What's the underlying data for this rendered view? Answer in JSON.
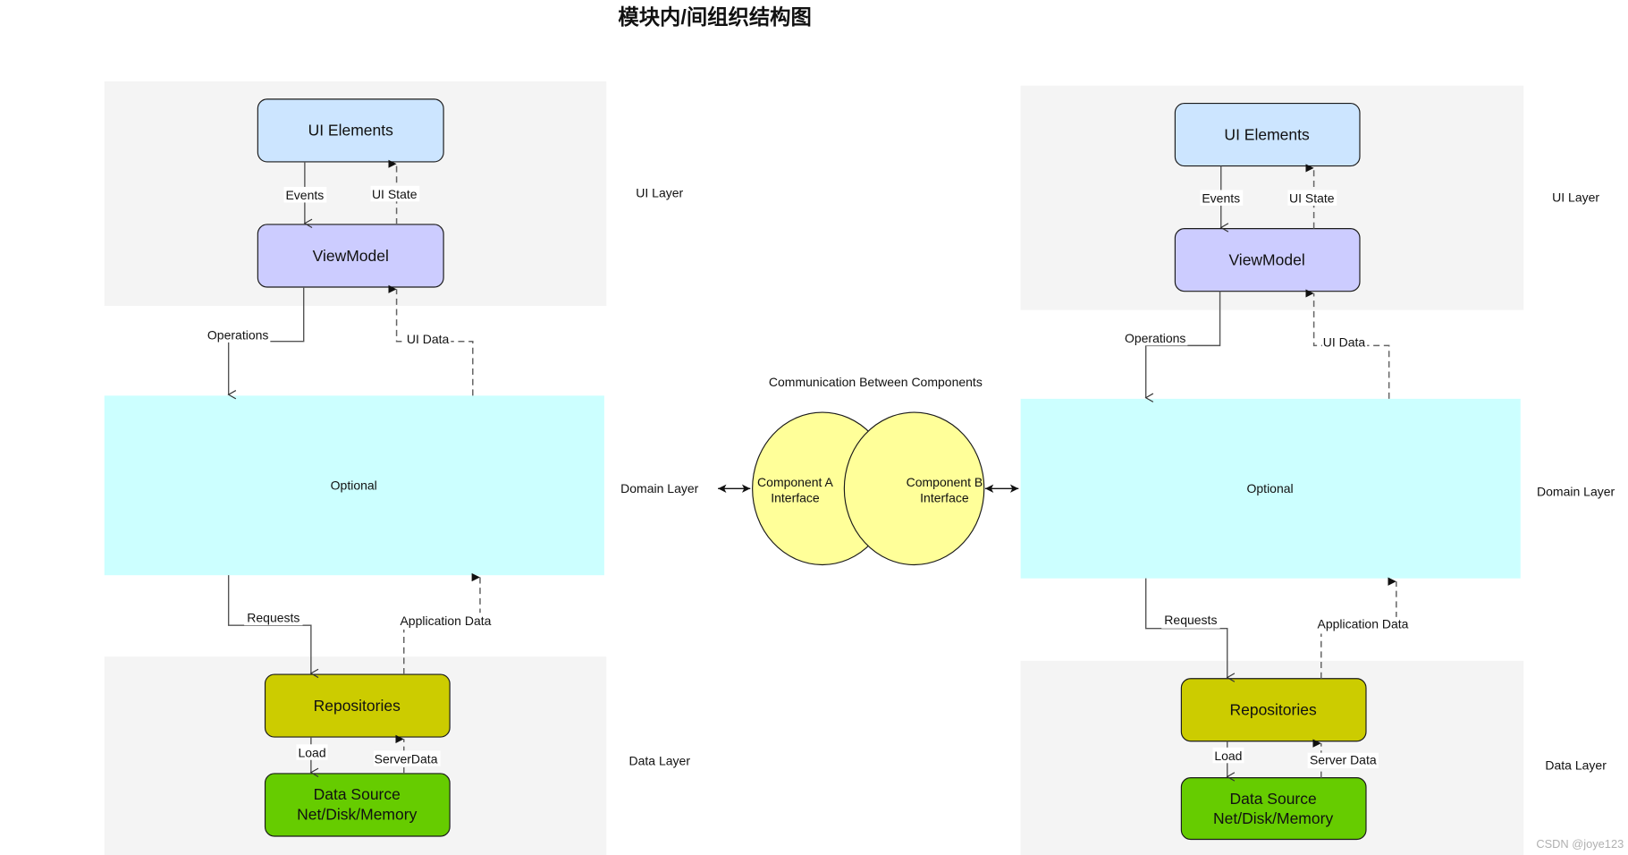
{
  "title": "模块内/间组织结构图",
  "watermark": "CSDN @joye123",
  "colors": {
    "layer_bg": "#f4f4f4",
    "domain_bg": "#ccffff",
    "ui_elements": "#cce5ff",
    "viewmodel": "#ccccff",
    "repositories": "#cccc00",
    "data_source": "#66cc00",
    "component": "#ffff99"
  },
  "left_module": {
    "ui_layer_label": "UI Layer",
    "domain_layer_label": "Domain Layer",
    "data_layer_label": "Data Layer",
    "ui_elements": "UI Elements",
    "viewmodel": "ViewModel",
    "domain_box": "Optional",
    "repositories": "Repositories",
    "data_source_line1": "Data Source",
    "data_source_line2": "Net/Disk/Memory",
    "edges": {
      "events": "Events",
      "ui_state": "UI State",
      "operations": "Operations",
      "ui_data": "UI Data",
      "requests": "Requests",
      "application_data": "Application Data",
      "load": "Load",
      "server_data": "ServerData"
    }
  },
  "right_module": {
    "ui_layer_label": "UI Layer",
    "domain_layer_label": "Domain Layer",
    "data_layer_label": "Data Layer",
    "ui_elements": "UI Elements",
    "viewmodel": "ViewModel",
    "domain_box": "Optional",
    "repositories": "Repositories",
    "data_source_line1": "Data Source",
    "data_source_line2": "Net/Disk/Memory",
    "edges": {
      "events": "Events",
      "ui_state": "UI State",
      "operations": "Operations",
      "ui_data": "UI Data",
      "requests": "Requests",
      "application_data": "Application Data",
      "load": "Load",
      "server_data": "Server Data"
    }
  },
  "communication": {
    "title": "Communication Between Components",
    "component_a_line1": "Component A",
    "component_a_line2": "Interface",
    "component_b_line1": "Component B",
    "component_b_line2": "Interface"
  }
}
